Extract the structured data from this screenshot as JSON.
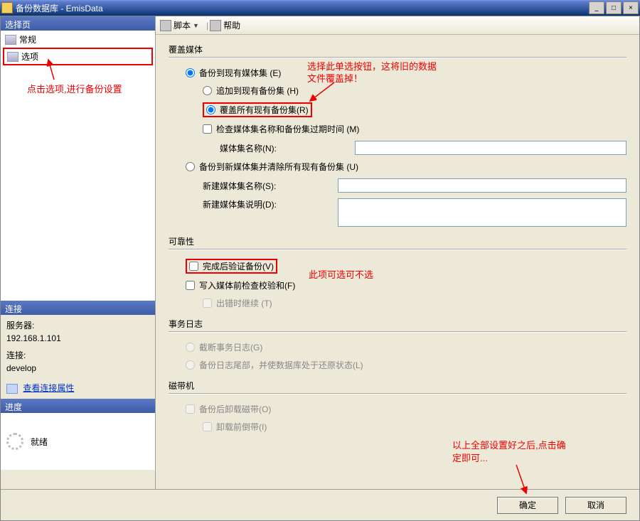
{
  "window": {
    "title": "备份数据库 - EmisData",
    "min_icon": "_",
    "max_icon": "□",
    "close_icon": "×"
  },
  "sidebar": {
    "header_select": "选择页",
    "nav": {
      "general": "常规",
      "options": "选项"
    },
    "header_conn": "连接",
    "conn": {
      "server_label": "服务器:",
      "server_value": "192.168.1.101",
      "conn_label": "连接:",
      "conn_value": "develop",
      "view_props": "查看连接属性"
    },
    "header_prog": "进度",
    "prog": {
      "ready": "就绪"
    }
  },
  "toolbar": {
    "script": "脚本",
    "help": "帮助"
  },
  "groups": {
    "overwrite": {
      "title": "覆盖媒体",
      "to_existing": "备份到现有媒体集 (E)",
      "append": "追加到现有备份集 (H)",
      "overwrite_all": "覆盖所有现有备份集(R)",
      "check_name": "检查媒体集名称和备份集过期时间 (M)",
      "media_name": "媒体集名称(N):",
      "to_new": "备份到新媒体集并清除所有现有备份集 (U)",
      "new_name": "新建媒体集名称(S):",
      "new_desc": "新建媒体集说明(D):"
    },
    "reliability": {
      "title": "可靠性",
      "verify": "完成后验证备份(V)",
      "checksum": "写入媒体前检查校验和(F)",
      "continue_err": "出错时继续 (T)"
    },
    "txlog": {
      "title": "事务日志",
      "truncate": "截断事务日志(G)",
      "tail": "备份日志尾部，并使数据库处于还原状态(L)"
    },
    "tape": {
      "title": "磁带机",
      "unload": "备份后卸载磁带(O)",
      "rewind": "卸载前倒带(I)"
    }
  },
  "buttons": {
    "ok": "确定",
    "cancel": "取消"
  },
  "annotations": {
    "sidebar_note": "点击选项,进行备份设置",
    "overwrite_note1": "选择此单选按钮，这将旧的数据",
    "overwrite_note2": "文件覆盖掉！",
    "verify_note": "此项可选可不选",
    "ok_note1": "以上全部设置好之后,点击确",
    "ok_note2": "定即可..."
  }
}
